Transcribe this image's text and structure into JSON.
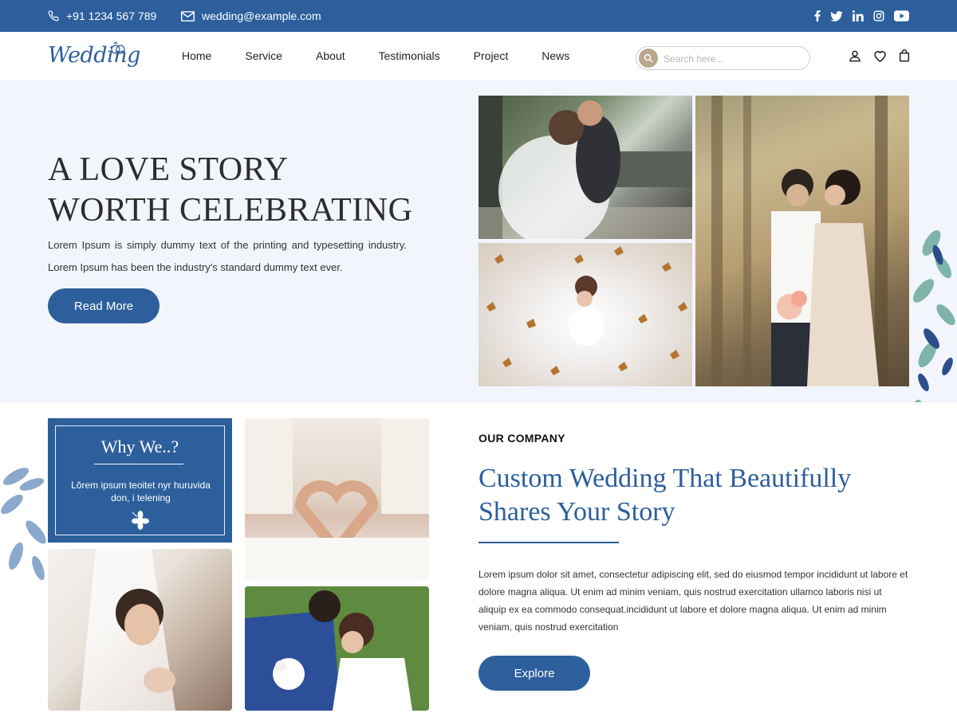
{
  "topbar": {
    "phone": "+91 1234 567 789",
    "email": "wedding@example.com",
    "social_icons": [
      "facebook-icon",
      "twitter-icon",
      "linkedin-icon",
      "instagram-icon",
      "youtube-icon"
    ]
  },
  "header": {
    "logo": "Wedding",
    "nav": [
      "Home",
      "Service",
      "About",
      "Testimonials",
      "Project",
      "News"
    ],
    "search": {
      "placeholder": "Search here...",
      "value": ""
    },
    "icons": [
      "user-icon",
      "heart-icon",
      "bag-icon"
    ]
  },
  "hero": {
    "title_line1": "A LOVE STORY",
    "title_line2": "WORTH CELEBRATING",
    "para1": "Lorem Ipsum is simply dummy text of the printing and typesetting industry.",
    "para2": "Lorem Ipsum has been the industry's standard dummy text ever.",
    "button": "Read More"
  },
  "why": {
    "title": "Why We..?",
    "text": "Lŏrem ipsum teoitet nyr huruvida don, i telening"
  },
  "company": {
    "eyebrow": "OUR COMPANY",
    "title_line1": "Custom Wedding That Beautifully",
    "title_line2": "Shares Your Story",
    "text": "Lorem ipsum dolor sit amet, consectetur adipiscing elit, sed do eiusmod tempor incididunt ut labore et dolore magna aliqua. Ut enim ad minim veniam, quis nostrud exercitation ullamco laboris nisi ut aliquip ex ea commodo consequat.incididunt ut labore et dolore magna aliqua. Ut enim ad minim veniam, quis nostrud exercitation",
    "button": "Explore"
  },
  "colors": {
    "primary": "#2c5f9c",
    "hero_bg": "#f2f5fc",
    "search_icon_bg": "#b9a78e"
  }
}
